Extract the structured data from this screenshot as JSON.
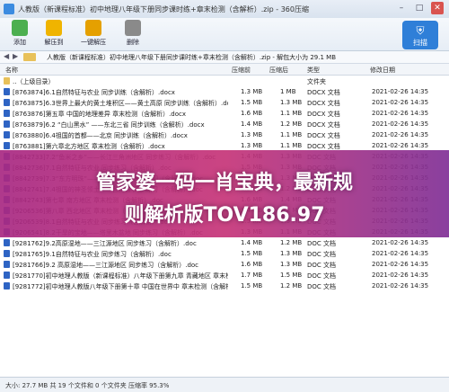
{
  "window": {
    "title": "人教版（新课程标准）初中地理八年级下册同步课时练+章末检测（含解析）.zip - 360压缩",
    "colors": {
      "accent": "#2f7fd8",
      "banner": "#c6347a"
    }
  },
  "toolbar": {
    "items": [
      {
        "label": "添加",
        "icon": "add-icon",
        "color": "#4caf50"
      },
      {
        "label": "解压到",
        "icon": "extract-icon",
        "color": "#f0b400"
      },
      {
        "label": "一键解压",
        "icon": "one-click-extract-icon",
        "color": "#e5a000"
      },
      {
        "label": "删除",
        "icon": "delete-icon",
        "color": "#8a8a8a"
      }
    ],
    "scan_label": "扫描"
  },
  "pathbar": {
    "path": "人教版（新课程标准）初中地理八年级下册同步课时练+章末检测（含解析）.zip - 解包大小为 29.1 MB"
  },
  "columns": {
    "name": "名称",
    "compressed": "压缩前",
    "original": "压缩后",
    "type": "类型",
    "modified": "修改日期"
  },
  "rows": [
    {
      "name": "..（上级目录）",
      "compressed": "",
      "original": "",
      "type": "文件夹",
      "date": ""
    },
    {
      "name": "[8763874]6.1自然特征与农业 同步训练（含解析）.docx",
      "compressed": "1.3 MB",
      "original": "1 MB",
      "type": "DOCX 文档",
      "date": "2021-02-26 14:35"
    },
    {
      "name": "[8763875]6.3世界上最大的黄土堆积区——黄土高原 同步训练（含解析）.docx",
      "compressed": "1.5 MB",
      "original": "1.3 MB",
      "type": "DOCX 文档",
      "date": "2021-02-26 14:35"
    },
    {
      "name": "[8763876]第五章 中国的地理差异 章末检测（含解析）.docx",
      "compressed": "1.6 MB",
      "original": "1.1 MB",
      "type": "DOCX 文档",
      "date": "2021-02-26 14:35"
    },
    {
      "name": "[8763879]6.2 “白山黑水” ——东北三省 同步训练（含解析）.docx",
      "compressed": "1.4 MB",
      "original": "1.2 MB",
      "type": "DOCX 文档",
      "date": "2021-02-26 14:35"
    },
    {
      "name": "[8763880]6.4祖国的首都——北京 同步训练（含解析）.docx",
      "compressed": "1.3 MB",
      "original": "1.1 MB",
      "type": "DOCX 文档",
      "date": "2021-02-26 14:35"
    },
    {
      "name": "[8763881]第六章北方地区 章末检测（含解析）.docx",
      "compressed": "1.3 MB",
      "original": "1.1 MB",
      "type": "DOCX 文档",
      "date": "2021-02-26 14:35"
    },
    {
      "name": "[8842733]7.2“鱼米之乡”——长江三角洲地区 同步练习（含解析）.doc",
      "compressed": "1.4 MB",
      "original": "1.3 MB",
      "type": "DOC 文档",
      "date": "2021-02-26 14:35"
    },
    {
      "name": "[8842736]7.1自然特征与农业 同步练习（含解析）.doc",
      "compressed": "1.5 MB",
      "original": "1.3 MB",
      "type": "DOC 文档",
      "date": "2021-02-26 14:35"
    },
    {
      "name": "[8842739]7.3“东方明珠”——香港和澳门 同步练习（含解析）.doc",
      "compressed": "1.5 MB",
      "original": "1.3 MB",
      "type": "DOC 文档",
      "date": "2021-02-26 14:35"
    },
    {
      "name": "[8842741]7.4祖国的神圣领土——台湾省 同步练习（含解析）.doc",
      "compressed": "1.3 MB",
      "original": "1.2 MB",
      "type": "DOC 文档",
      "date": "2021-02-26 14:35"
    },
    {
      "name": "[8842743]第七章 南方地区 章末检测（含解析）.doc",
      "compressed": "1.6 MB",
      "original": "1.4 MB",
      "type": "DOC 文档",
      "date": "2021-02-26 14:35"
    },
    {
      "name": "[9206536]第八章 西北地区 章末检测（含解析）.doc",
      "compressed": "1.4 MB",
      "original": "1.2 MB",
      "type": "DOC 文档",
      "date": "2021-02-26 14:35"
    },
    {
      "name": "[9206539]8.1自然特征与农业 同步练习（含解析）.doc",
      "compressed": "1.5 MB",
      "original": "1.3 MB",
      "type": "DOC 文档",
      "date": "2021-02-26 14:35"
    },
    {
      "name": "[9206541]8.2干旱的宝地——塔里木盆地 同步练习（含解析）.doc",
      "compressed": "1.3 MB",
      "original": "1.1 MB",
      "type": "DOC 文档",
      "date": "2021-02-26 14:35"
    },
    {
      "name": "[9281762]9.2高原湿地——三江源地区 同步练习（含解析）.doc",
      "compressed": "1.4 MB",
      "original": "1.2 MB",
      "type": "DOC 文档",
      "date": "2021-02-26 14:35"
    },
    {
      "name": "[9281765]9.1自然特征与农业 同步练习（含解析）.doc",
      "compressed": "1.5 MB",
      "original": "1.3 MB",
      "type": "DOC 文档",
      "date": "2021-02-26 14:35"
    },
    {
      "name": "[9281766]9.2 高原湿地——三江源地区 同步练习（含解析）.doc",
      "compressed": "1.6 MB",
      "original": "1.3 MB",
      "type": "DOC 文档",
      "date": "2021-02-26 14:35"
    },
    {
      "name": "[9281770]初中地理人教版（新课程标准）八年级下册第九章 青藏地区 章末检测（含解析）.doc",
      "compressed": "1.7 MB",
      "original": "1.5 MB",
      "type": "DOC 文档",
      "date": "2021-02-26 14:35"
    },
    {
      "name": "[9281772]初中地理人教版八年级下册第十章 中国在世界中 章末检测（含解析）.doc",
      "compressed": "1.5 MB",
      "original": "1.2 MB",
      "type": "DOC 文档",
      "date": "2021-02-26 14:35"
    }
  ],
  "banner": {
    "line1": "管家婆一码一肖宝典，最新规",
    "line2": "则解析版TOV186.97"
  },
  "status": {
    "text": "大小: 27.7 MB 共 19 个文件和 0 个文件夹 压缩率 95.3%"
  }
}
